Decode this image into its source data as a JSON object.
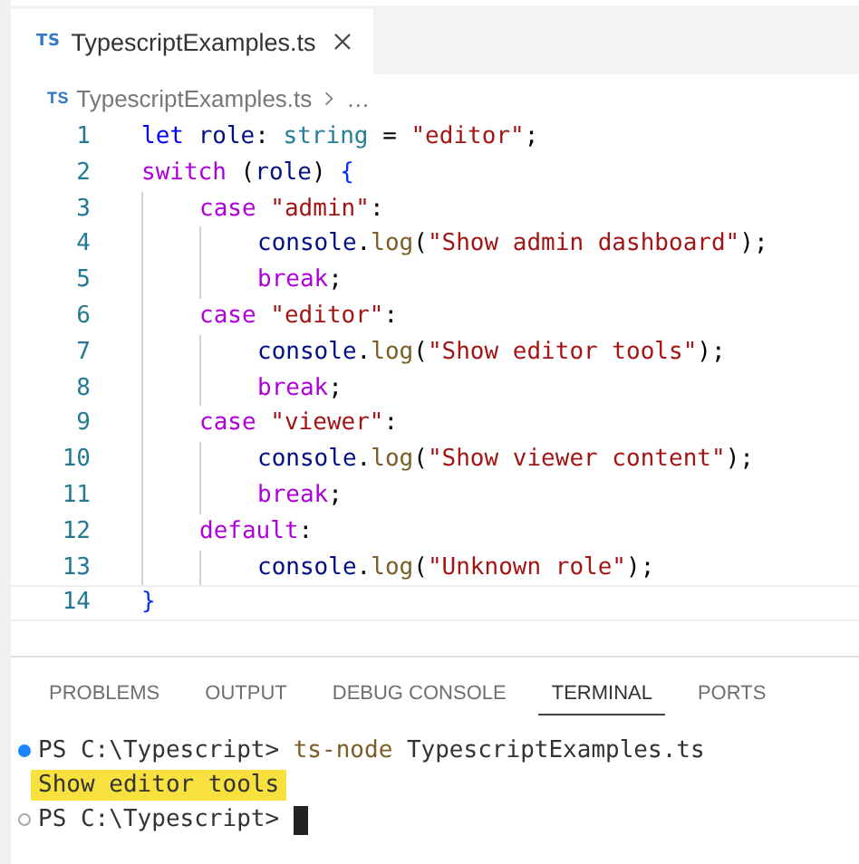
{
  "editor_tabs": [
    {
      "icon_text": "TS",
      "label": "TypescriptExamples.ts",
      "selected": true
    }
  ],
  "breadcrumb": {
    "icon_text": "TS",
    "file": "TypescriptExamples.ts",
    "more": "…"
  },
  "code_lines": [
    {
      "number": "1",
      "tokens": [
        {
          "t": "let ",
          "kind": "keyword"
        },
        {
          "t": "role",
          "kind": "variable"
        },
        {
          "t": ": ",
          "kind": "plain"
        },
        {
          "t": "string",
          "kind": "type"
        },
        {
          "t": " = ",
          "kind": "plain"
        },
        {
          "t": "\"editor\"",
          "kind": "string"
        },
        {
          "t": ";",
          "kind": "plain"
        }
      ]
    },
    {
      "number": "2",
      "tokens": [
        {
          "t": "switch",
          "kind": "control"
        },
        {
          "t": " (",
          "kind": "plain"
        },
        {
          "t": "role",
          "kind": "variable"
        },
        {
          "t": ") ",
          "kind": "plain"
        },
        {
          "t": "{",
          "kind": "bracket"
        }
      ],
      "children": [
        {
          "number": "3",
          "tokens": [
            {
              "t": "case ",
              "kind": "control"
            },
            {
              "t": "\"admin\"",
              "kind": "string"
            },
            {
              "t": ":",
              "kind": "plain"
            }
          ],
          "children": [
            {
              "number": "4",
              "tokens": [
                {
                  "t": "console",
                  "kind": "variable"
                },
                {
                  "t": ".",
                  "kind": "plain"
                },
                {
                  "t": "log",
                  "kind": "function"
                },
                {
                  "t": "(",
                  "kind": "plain"
                },
                {
                  "t": "\"Show admin dashboard\"",
                  "kind": "string"
                },
                {
                  "t": ");",
                  "kind": "plain"
                }
              ]
            },
            {
              "number": "5",
              "tokens": [
                {
                  "t": "break",
                  "kind": "control"
                },
                {
                  "t": ";",
                  "kind": "plain"
                }
              ]
            }
          ]
        },
        {
          "number": "6",
          "tokens": [
            {
              "t": "case ",
              "kind": "control"
            },
            {
              "t": "\"editor\"",
              "kind": "string"
            },
            {
              "t": ":",
              "kind": "plain"
            }
          ],
          "children": [
            {
              "number": "7",
              "tokens": [
                {
                  "t": "console",
                  "kind": "variable"
                },
                {
                  "t": ".",
                  "kind": "plain"
                },
                {
                  "t": "log",
                  "kind": "function"
                },
                {
                  "t": "(",
                  "kind": "plain"
                },
                {
                  "t": "\"Show editor tools\"",
                  "kind": "string"
                },
                {
                  "t": ");",
                  "kind": "plain"
                }
              ]
            },
            {
              "number": "8",
              "tokens": [
                {
                  "t": "break",
                  "kind": "control"
                },
                {
                  "t": ";",
                  "kind": "plain"
                }
              ]
            }
          ]
        },
        {
          "number": "9",
          "tokens": [
            {
              "t": "case ",
              "kind": "control"
            },
            {
              "t": "\"viewer\"",
              "kind": "string"
            },
            {
              "t": ":",
              "kind": "plain"
            }
          ],
          "children": [
            {
              "number": "10",
              "tokens": [
                {
                  "t": "console",
                  "kind": "variable"
                },
                {
                  "t": ".",
                  "kind": "plain"
                },
                {
                  "t": "log",
                  "kind": "function"
                },
                {
                  "t": "(",
                  "kind": "plain"
                },
                {
                  "t": "\"Show viewer content\"",
                  "kind": "string"
                },
                {
                  "t": ");",
                  "kind": "plain"
                }
              ]
            },
            {
              "number": "11",
              "tokens": [
                {
                  "t": "break",
                  "kind": "control"
                },
                {
                  "t": ";",
                  "kind": "plain"
                }
              ]
            }
          ]
        },
        {
          "number": "12",
          "tokens": [
            {
              "t": "default",
              "kind": "control"
            },
            {
              "t": ":",
              "kind": "plain"
            }
          ],
          "children": [
            {
              "number": "13",
              "tokens": [
                {
                  "t": "console",
                  "kind": "variable"
                },
                {
                  "t": ".",
                  "kind": "plain"
                },
                {
                  "t": "log",
                  "kind": "function"
                },
                {
                  "t": "(",
                  "kind": "plain"
                },
                {
                  "t": "\"Unknown role\"",
                  "kind": "string"
                },
                {
                  "t": ");",
                  "kind": "plain"
                }
              ]
            }
          ]
        }
      ]
    },
    {
      "number": "14",
      "tokens": [
        {
          "t": "}",
          "kind": "bracket"
        }
      ],
      "current": true
    }
  ],
  "panel_tabs": [
    {
      "label": "PROBLEMS",
      "selected": false
    },
    {
      "label": "OUTPUT",
      "selected": false
    },
    {
      "label": "DEBUG CONSOLE",
      "selected": false
    },
    {
      "label": "TERMINAL",
      "selected": true
    },
    {
      "label": "PORTS",
      "selected": false
    }
  ],
  "terminal_lines": [
    {
      "kind": "command",
      "finished": true,
      "prompt": "PS C:\\Typescript>",
      "command": "ts-node",
      "args": "TypescriptExamples.ts"
    },
    {
      "kind": "output",
      "text": "Show editor tools",
      "highlighted": true
    },
    {
      "kind": "prompt",
      "finished": false,
      "prompt": "PS C:\\Typescript>",
      "cursor": true
    }
  ]
}
